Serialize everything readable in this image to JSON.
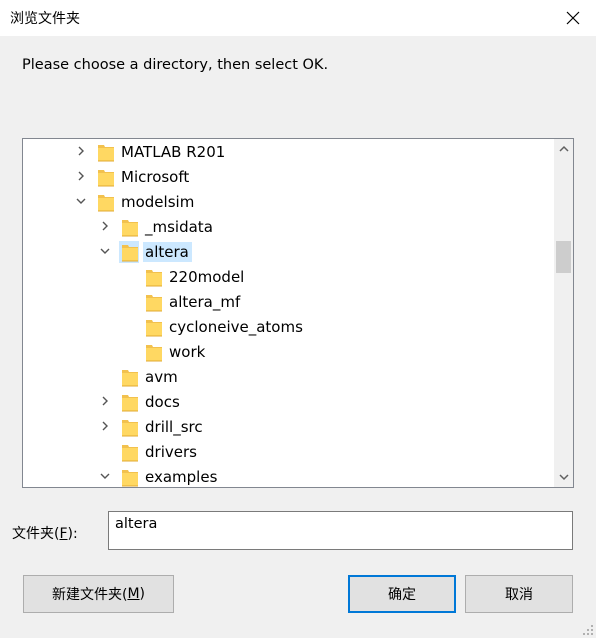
{
  "window": {
    "title": "浏览文件夹",
    "close_icon": "close-icon"
  },
  "instruction": "Please choose a directory, then select OK.",
  "tree": {
    "items": [
      {
        "label": "MATLAB R201",
        "level": 0,
        "expander": "collapsed",
        "selected": false
      },
      {
        "label": "Microsoft",
        "level": 0,
        "expander": "collapsed",
        "selected": false
      },
      {
        "label": "modelsim",
        "level": 0,
        "expander": "expanded",
        "selected": false
      },
      {
        "label": "_msidata",
        "level": 1,
        "expander": "collapsed",
        "selected": false
      },
      {
        "label": "altera",
        "level": 1,
        "expander": "expanded",
        "selected": true
      },
      {
        "label": "220model",
        "level": 2,
        "expander": "none",
        "selected": false
      },
      {
        "label": "altera_mf",
        "level": 2,
        "expander": "none",
        "selected": false
      },
      {
        "label": "cycloneive_atoms",
        "level": 2,
        "expander": "none",
        "selected": false
      },
      {
        "label": "work",
        "level": 2,
        "expander": "none",
        "selected": false
      },
      {
        "label": "avm",
        "level": 1,
        "expander": "none",
        "selected": false
      },
      {
        "label": "docs",
        "level": 1,
        "expander": "collapsed",
        "selected": false
      },
      {
        "label": "drill_src",
        "level": 1,
        "expander": "collapsed",
        "selected": false
      },
      {
        "label": "drivers",
        "level": 1,
        "expander": "none",
        "selected": false
      },
      {
        "label": "examples",
        "level": 1,
        "expander": "expanded",
        "selected": false
      }
    ],
    "scroll_position": 0.3
  },
  "folder_field": {
    "label_main": "文件夹(",
    "label_accel": "F",
    "label_end": "):",
    "value": "altera"
  },
  "buttons": {
    "new_folder_main": "新建文件夹(",
    "new_folder_accel": "M",
    "new_folder_end": ")",
    "ok": "确定",
    "cancel": "取消"
  },
  "colors": {
    "selection": "#cce8ff",
    "folder_fill": "#ffd862",
    "folder_back": "#f2c14e",
    "default_button_border": "#0078d7"
  }
}
